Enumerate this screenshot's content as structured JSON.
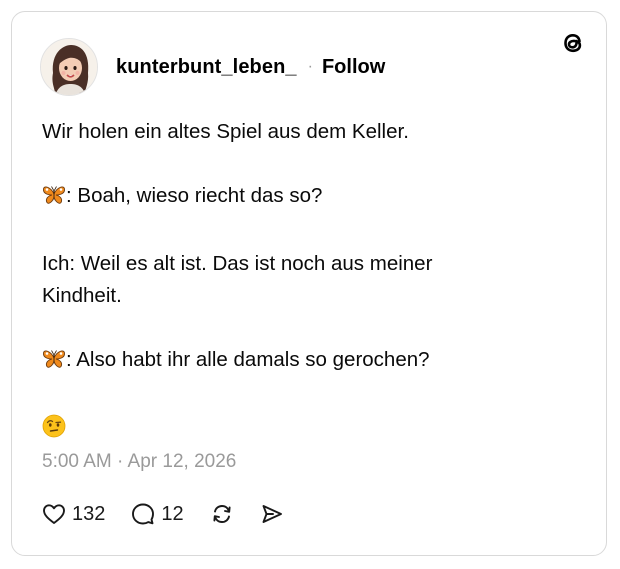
{
  "post": {
    "username": "kunterbunt_leben_",
    "separator": "·",
    "follow_label": "Follow",
    "lines": [
      "Wir holen ein altes Spiel aus dem Keller.",
      ": Boah, wieso riecht das so?",
      "Ich: Weil es alt ist. Das ist noch aus meiner Kindheit.",
      ": Also habt ihr alle damals so gerochen?"
    ],
    "timestamp": "5:00 AM · Apr 12, 2026",
    "like_count": "132",
    "reply_count": "12"
  },
  "icons": {
    "logo": "threads-logo-icon",
    "like": "heart-icon",
    "reply": "speech-bubble-icon",
    "repost": "repost-icon",
    "share": "send-icon",
    "emoji_butterfly": "butterfly-emoji-icon",
    "emoji_raised_eyebrow": "raised-eyebrow-emoji-icon"
  }
}
